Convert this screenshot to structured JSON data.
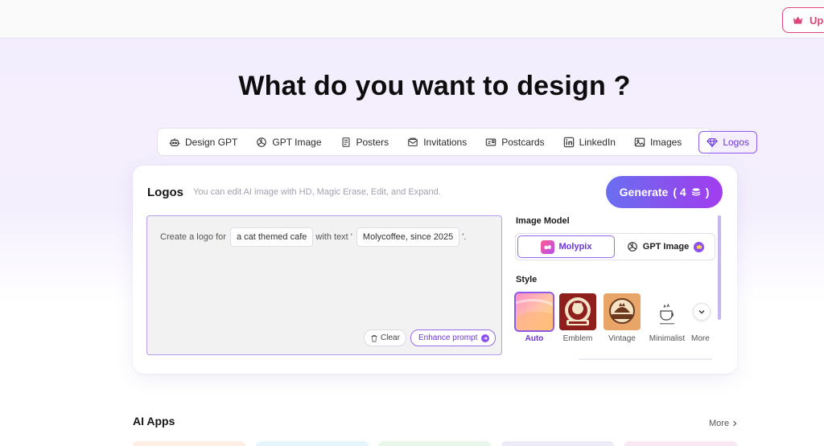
{
  "header": {
    "upgrade_label": "Upg"
  },
  "hero": {
    "title": "What do you want to design ?"
  },
  "tabs": [
    {
      "label": "Design GPT",
      "icon": "robot-icon"
    },
    {
      "label": "GPT Image",
      "icon": "openai-icon"
    },
    {
      "label": "Posters",
      "icon": "poster-icon"
    },
    {
      "label": "Invitations",
      "icon": "envelope-icon"
    },
    {
      "label": "Postcards",
      "icon": "postcard-icon"
    },
    {
      "label": "LinkedIn",
      "icon": "linkedin-icon"
    },
    {
      "label": "Images",
      "icon": "image-icon"
    },
    {
      "label": "Logos",
      "icon": "diamond-icon",
      "active": true
    }
  ],
  "card": {
    "title": "Logos",
    "subtitle": "You can edit AI image with HD, Magic Erase, Edit, and Expand.",
    "generate_label": "Generate",
    "generate_cost": "( 4",
    "generate_cost_close": ")"
  },
  "prompt": {
    "prefix": "Create a logo for",
    "subject": "a cat themed cafe",
    "middle": "with text '",
    "text_value": "Molycoffee, since 2025",
    "suffix": "'.",
    "clear_label": "Clear",
    "enhance_label": "Enhance prompt"
  },
  "image_model": {
    "label": "Image Model",
    "options": [
      {
        "label": "Molypix",
        "selected": true
      },
      {
        "label": "GPT Image",
        "selected": false
      }
    ]
  },
  "style": {
    "label": "Style",
    "options": [
      {
        "label": "Auto",
        "selected": true
      },
      {
        "label": "Emblem",
        "selected": false
      },
      {
        "label": "Vintage",
        "selected": false
      },
      {
        "label": "Minimalist",
        "selected": false
      }
    ],
    "more_label": "More"
  },
  "apps": {
    "title": "AI Apps",
    "more_label": "More"
  },
  "colors": {
    "accent": "#8b4fee",
    "upgrade": "#e0457b"
  }
}
